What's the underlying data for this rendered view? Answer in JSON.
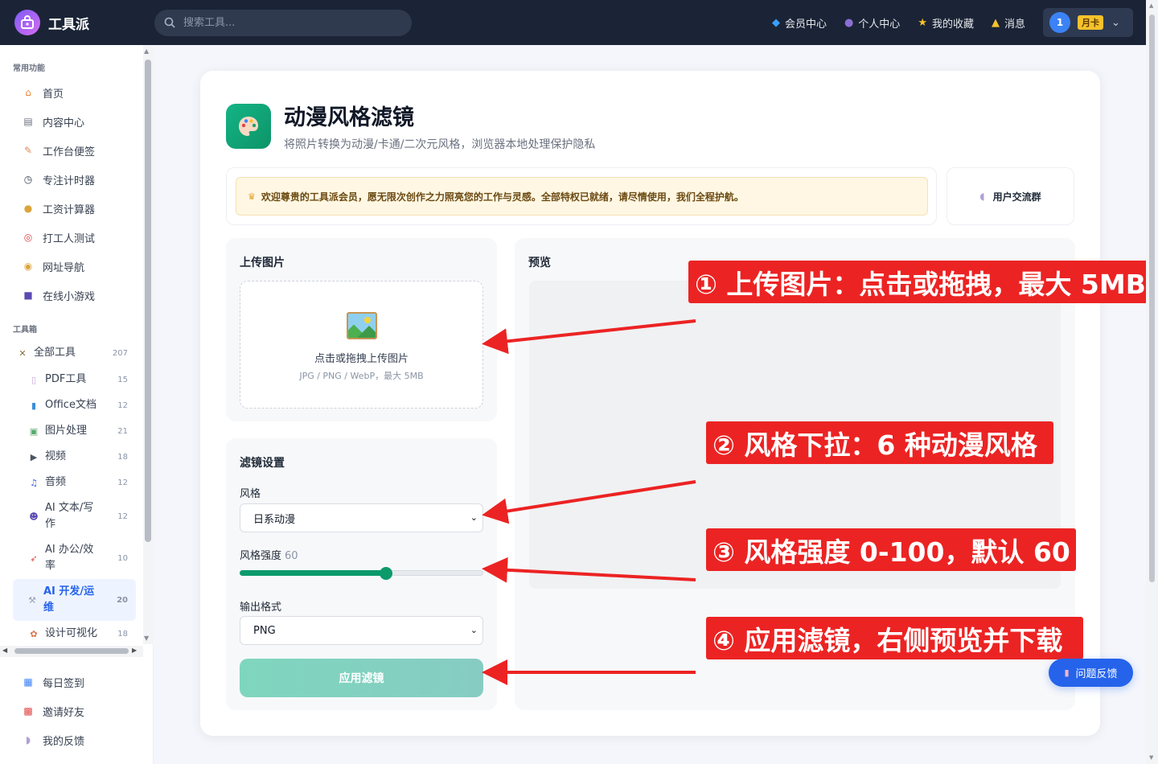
{
  "app": {
    "name": "工具派",
    "logo_icon": "logo-icon"
  },
  "search": {
    "placeholder": "搜索工具..."
  },
  "topnav": [
    {
      "icon": "diamond-icon",
      "label": "会员中心"
    },
    {
      "icon": "person-icon",
      "label": "个人中心"
    },
    {
      "icon": "star-icon",
      "label": "我的收藏"
    },
    {
      "icon": "bell-icon",
      "label": "消息"
    }
  ],
  "user": {
    "avatar": "1",
    "badge": "月卡"
  },
  "sidebar": {
    "section_common": "常用功能",
    "common": [
      {
        "icon": "home-icon",
        "label": "首页"
      },
      {
        "icon": "content-icon",
        "label": "内容中心"
      },
      {
        "icon": "note-icon",
        "label": "工作台便签"
      },
      {
        "icon": "timer-icon",
        "label": "专注计时器"
      },
      {
        "icon": "money-bag-icon",
        "label": "工资计算器"
      },
      {
        "icon": "target-icon",
        "label": "打工人测试"
      },
      {
        "icon": "compass-icon",
        "label": "网址导航"
      },
      {
        "icon": "gamepad-icon",
        "label": "在线小游戏"
      }
    ],
    "section_tools": "工具箱",
    "all_tools": {
      "icon": "tools-icon",
      "label": "全部工具",
      "count": "207"
    },
    "categories": [
      {
        "icon": "pdf-icon",
        "label": "PDF工具",
        "count": "15"
      },
      {
        "icon": "office-icon",
        "label": "Office文档",
        "count": "12"
      },
      {
        "icon": "image-icon",
        "label": "图片处理",
        "count": "21"
      },
      {
        "icon": "video-icon",
        "label": "视频",
        "count": "18"
      },
      {
        "icon": "music-icon",
        "label": "音频",
        "count": "12"
      },
      {
        "icon": "robot-icon",
        "label": "AI 文本/写作",
        "count": "12"
      },
      {
        "icon": "rocket-icon",
        "label": "AI 办公/效率",
        "count": "10"
      },
      {
        "icon": "dev-icon",
        "label": "AI 开发/运维",
        "count": "20",
        "active": true
      },
      {
        "icon": "palette-icon",
        "label": "设计可视化",
        "count": "18"
      }
    ],
    "bottom": [
      {
        "icon": "calendar-icon",
        "label": "每日签到"
      },
      {
        "icon": "gift-icon",
        "label": "邀请好友"
      },
      {
        "icon": "chat-icon",
        "label": "我的反馈"
      }
    ]
  },
  "page": {
    "title": "动漫风格滤镜",
    "subtitle": "将照片转换为动漫/卡通/二次元风格，浏览器本地处理保护隐私",
    "icon": "palette-icon"
  },
  "notice": {
    "icon": "crown-icon",
    "text": "欢迎尊贵的工具派会员，愿无限次创作之力照亮您的工作与灵感。全部特权已就绪，请尽情使用，我们全程护航。"
  },
  "group": {
    "icon": "chat-bubble-icon",
    "label": "用户交流群"
  },
  "upload": {
    "title": "上传图片",
    "icon": "picture-icon",
    "text": "点击或拖拽上传图片",
    "hint": "JPG / PNG / WebP，最大 5MB"
  },
  "settings": {
    "title": "滤镜设置",
    "style_label": "风格",
    "style_value": "日系动漫",
    "intensity_label": "风格强度",
    "intensity_value": "60",
    "intensity_fraction": 0.6,
    "format_label": "输出格式",
    "format_value": "PNG",
    "apply_label": "应用滤镜"
  },
  "preview": {
    "title": "预览"
  },
  "callouts": [
    "① 上传图片：点击或拖拽，最大 5MB",
    "② 风格下拉：6 种动漫风格",
    "③ 风格强度 0-100，默认 60",
    "④ 应用滤镜，右侧预览并下载"
  ],
  "colors": {
    "accent": "#0c9a6b",
    "callout": "#ec2323",
    "topbar": "#1b2436",
    "primary": "#2563eb"
  },
  "feedback": {
    "icon": "document-icon",
    "label": "问题反馈"
  }
}
